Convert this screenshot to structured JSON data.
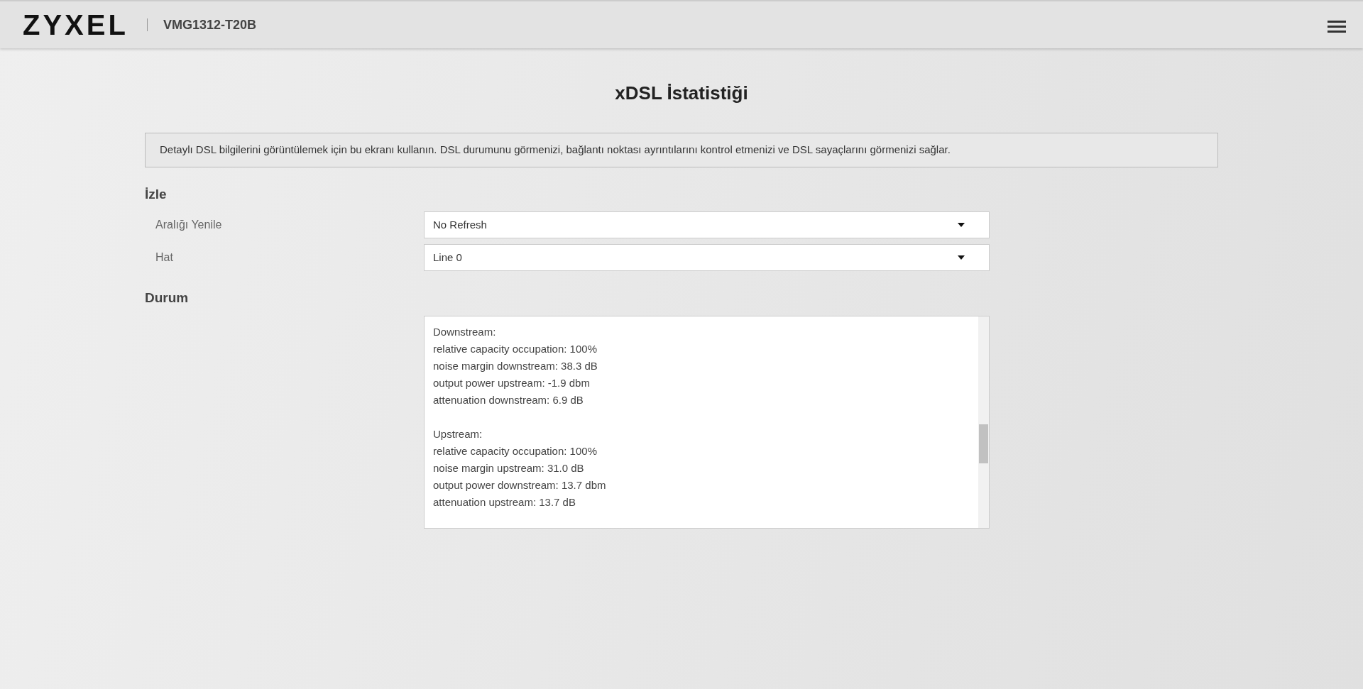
{
  "header": {
    "logo": "ZYXEL",
    "model": "VMG1312-T20B"
  },
  "page_title": "xDSL İstatistiği",
  "description": "Detaylı DSL bilgilerini görüntülemek için bu ekranı kullanın. DSL durumunu görmenizi, bağlantı noktası ayrıntılarını kontrol etmenizi ve DSL sayaçlarını görmenizi sağlar.",
  "monitor": {
    "heading": "İzle",
    "fields": [
      {
        "label": "Aralığı Yenile",
        "value": "No Refresh"
      },
      {
        "label": "Hat",
        "value": "Line 0"
      }
    ]
  },
  "status": {
    "heading": "Durum",
    "blocks": [
      {
        "lines": [
          "Downstream:",
          "relative capacity occupation: 100%",
          "noise margin downstream: 38.3 dB",
          "output power upstream: -1.9 dbm",
          "attenuation downstream: 6.9 dB"
        ]
      },
      {
        "lines": [
          "Upstream:",
          "relative capacity occupation: 100%",
          "noise margin upstream: 31.0 dB",
          "output power downstream: 13.7 dbm",
          "attenuation upstream: 13.7 dB"
        ]
      }
    ]
  }
}
